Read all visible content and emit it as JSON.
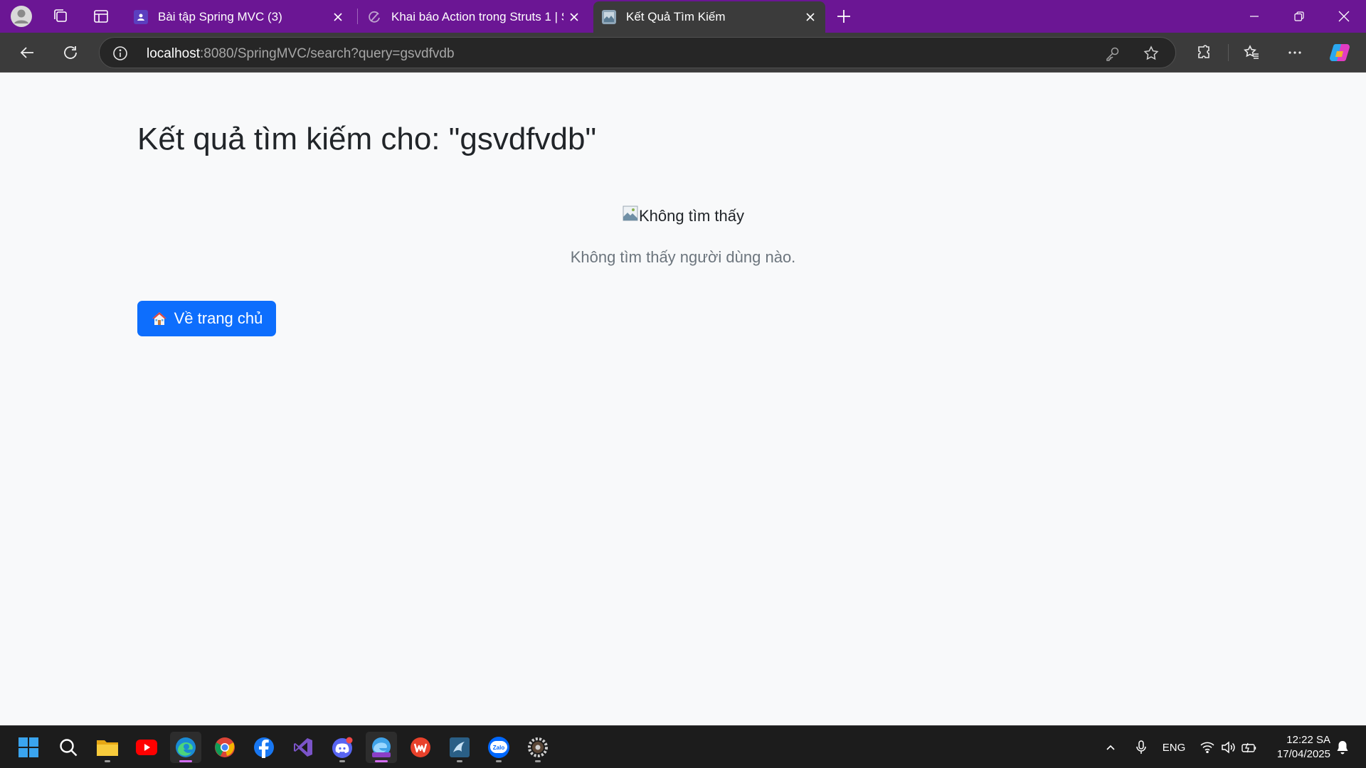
{
  "browser": {
    "tabs": [
      {
        "title": "Bài tập Spring MVC (3)",
        "active": false
      },
      {
        "title": "Khai báo Action trong Struts 1 | Sh",
        "active": false
      },
      {
        "title": "Kết Quả Tìm Kiếm",
        "active": true
      }
    ],
    "url": {
      "host": "localhost",
      "rest": ":8080/SpringMVC/search?query=gsvdfvdb"
    },
    "colors": {
      "frame": "#6b1694",
      "toolbar": "#3b3b3b"
    }
  },
  "page": {
    "title": "Kết quả tìm kiếm cho: \"gsvdfvdb\"",
    "image_alt": "Không tìm thấy",
    "empty_message": "Không tìm thấy người dùng nào.",
    "home_button_label": "Về trang chủ",
    "home_button_icon": "house-icon",
    "colors": {
      "primary": "#0d6efd",
      "muted": "#6c757d",
      "text": "#212529"
    }
  },
  "taskbar": {
    "apps": [
      "start-icon",
      "search-icon",
      "file-explorer-icon",
      "youtube-icon",
      "edge-icon",
      "chrome-icon",
      "facebook-icon",
      "visual-studio-icon",
      "discord-icon",
      "edge-preview-icon",
      "wps-office-icon",
      "mysql-workbench-icon",
      "zalo-icon",
      "settings-gear-icon"
    ],
    "language": "ENG",
    "time": "12:22 SA",
    "date": "17/04/2025"
  }
}
